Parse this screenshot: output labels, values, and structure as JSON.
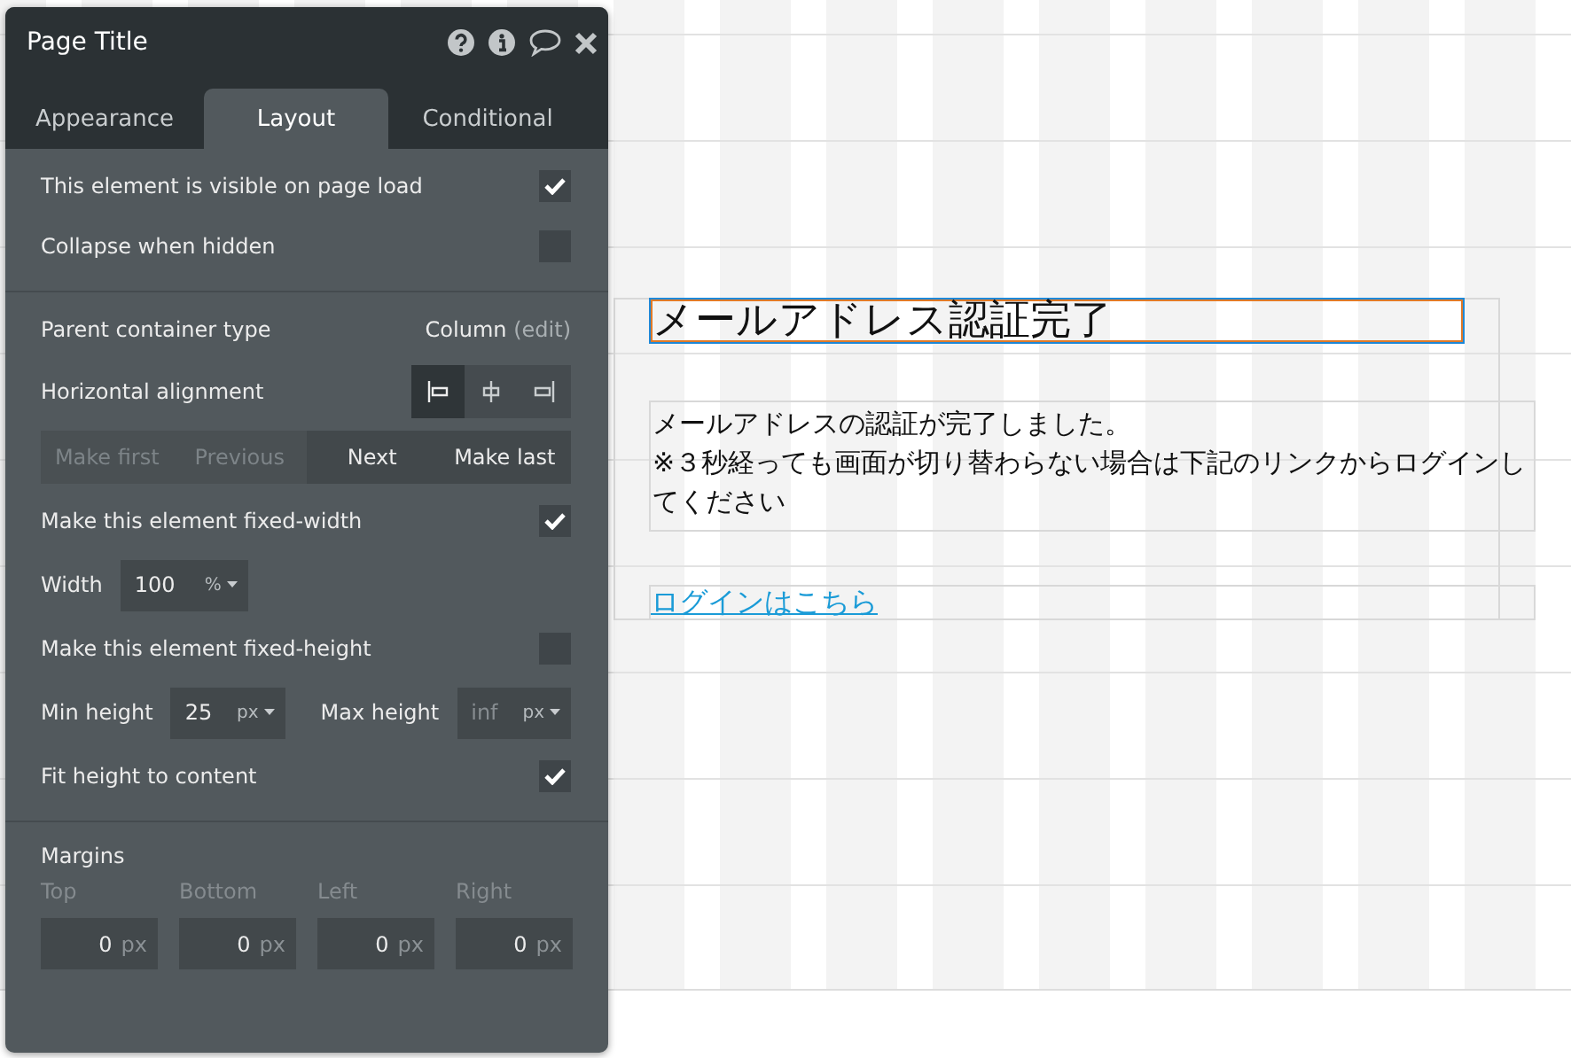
{
  "panel": {
    "title": "Page Title",
    "tabs": [
      {
        "label": "Appearance",
        "selected": false
      },
      {
        "label": "Layout",
        "selected": true
      },
      {
        "label": "Conditional",
        "selected": false
      }
    ],
    "sections": [
      {
        "rows": [
          {
            "kind": "checkbox",
            "label": "This element is visible on page load",
            "checked": true
          },
          {
            "kind": "checkbox",
            "label": "Collapse when hidden",
            "checked": false
          }
        ]
      },
      {
        "rows": [
          {
            "kind": "value",
            "label": "Parent container type",
            "value": "Column",
            "link": "(edit)"
          },
          {
            "kind": "segmented",
            "label": "Horizontal alignment",
            "options": [
              {
                "kind": "left",
                "selected": true
              },
              {
                "kind": "center",
                "selected": false
              },
              {
                "kind": "right",
                "selected": false
              }
            ]
          },
          {
            "kind": "buttons",
            "items": [
              {
                "label": "Make first",
                "disabled": true
              },
              {
                "label": "Previous",
                "disabled": true
              },
              {
                "label": "Next",
                "disabled": false
              },
              {
                "label": "Make last",
                "disabled": false
              }
            ]
          },
          {
            "kind": "checkbox",
            "label": "Make this element fixed-width",
            "checked": true
          },
          {
            "kind": "fields",
            "fields": [
              {
                "label": "Width",
                "value": "100",
                "unit": "%",
                "disabled": false
              }
            ]
          },
          {
            "kind": "checkbox",
            "label": "Make this element fixed-height",
            "checked": false
          },
          {
            "kind": "fields",
            "fields": [
              {
                "label": "Min height",
                "value": "25",
                "unit": "px",
                "disabled": false
              },
              {
                "label": "Max height",
                "value": "inf",
                "unit": "px",
                "disabled": true
              }
            ]
          },
          {
            "kind": "checkbox",
            "label": "Fit height to content",
            "checked": true
          }
        ]
      },
      {
        "rows": [
          {
            "kind": "margins",
            "label": "Margins",
            "fields": [
              {
                "label": "Top",
                "value": "0",
                "unit": "px"
              },
              {
                "label": "Bottom",
                "value": "0",
                "unit": "px"
              },
              {
                "label": "Left",
                "value": "0",
                "unit": "px"
              },
              {
                "label": "Right",
                "value": "0",
                "unit": "px"
              }
            ]
          }
        ]
      }
    ]
  },
  "canvas": {
    "heading": "メールアドレス認証完了",
    "message": [
      "メールアドレスの認証が完了しました。",
      "※３秒経っても画面が切り替わらない場合は下記のリンクからログインしてください"
    ],
    "link": "ログインはこちら"
  }
}
